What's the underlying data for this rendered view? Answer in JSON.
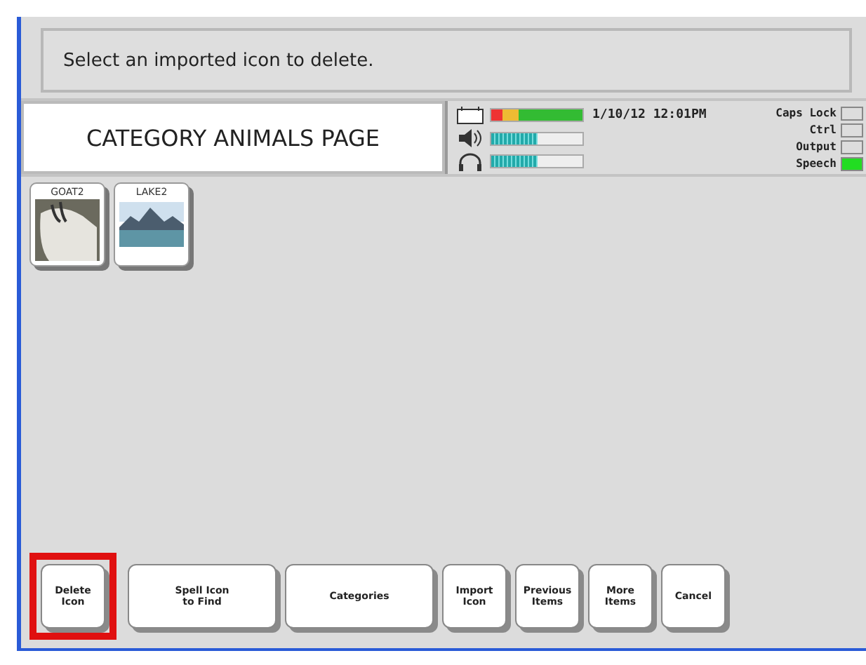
{
  "message": "Select an imported icon to delete.",
  "page_title": "CATEGORY ANIMALS PAGE",
  "meters": [
    {
      "kind": "battery",
      "level": 1.0
    },
    {
      "kind": "volume",
      "level": 0.5
    },
    {
      "kind": "headphones",
      "level": 0.5
    }
  ],
  "datetime": "1/10/12 12:01PM",
  "indicators": [
    {
      "label": "Caps Lock",
      "on": false
    },
    {
      "label": "Ctrl",
      "on": false
    },
    {
      "label": "Output",
      "on": false
    },
    {
      "label": "Speech",
      "on": true
    }
  ],
  "icons": [
    {
      "label": "GOAT2",
      "kind": "goat"
    },
    {
      "label": "LAKE2",
      "kind": "lake"
    }
  ],
  "buttons": [
    {
      "label": "Delete\nIcon",
      "highlighted": true
    },
    {
      "label": "Spell Icon\nto Find",
      "highlighted": false
    },
    {
      "label": "Categories",
      "highlighted": false
    },
    {
      "label": "Import\nIcon",
      "highlighted": false
    },
    {
      "label": "Previous\nItems",
      "highlighted": false
    },
    {
      "label": "More\nItems",
      "highlighted": false
    },
    {
      "label": "Cancel",
      "highlighted": false
    }
  ]
}
